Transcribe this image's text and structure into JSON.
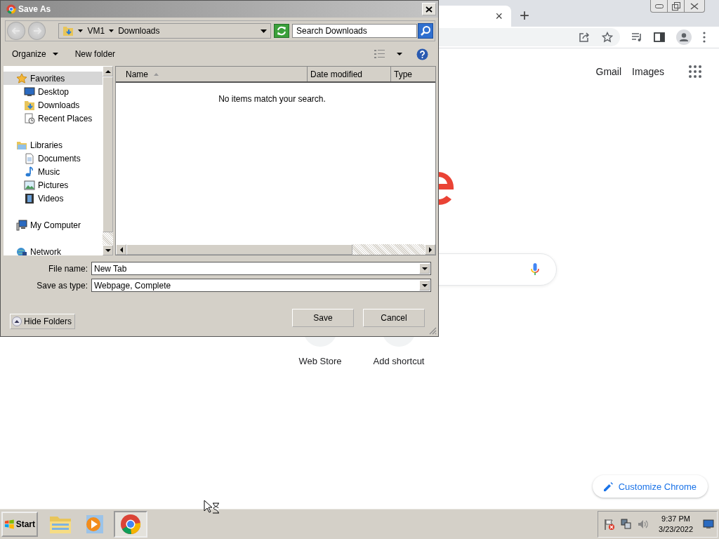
{
  "browser": {
    "tab_close": "×",
    "new_tab": "+",
    "header_links": [
      "Gmail",
      "Images"
    ],
    "shortcuts": [
      "Web Store",
      "Add shortcut"
    ],
    "customize": "Customize Chrome"
  },
  "dialog": {
    "title": "Save As",
    "breadcrumb": [
      "VM1",
      "Downloads"
    ],
    "search": {
      "placeholder": "Search Downloads"
    },
    "commands": [
      {
        "label": "Organize",
        "dropdown": true
      },
      {
        "label": "New folder",
        "dropdown": false
      }
    ],
    "nav": [
      {
        "label": "Favorites",
        "kind": "favorites",
        "selected": true,
        "children": [
          {
            "label": "Desktop",
            "kind": "desktop",
            "selected": false
          },
          {
            "label": "Downloads",
            "kind": "downloads",
            "selected": false
          },
          {
            "label": "Recent Places",
            "kind": "recent",
            "selected": false
          }
        ]
      },
      {
        "label": "Libraries",
        "kind": "libraries",
        "selected": false,
        "children": [
          {
            "label": "Documents",
            "kind": "documents",
            "selected": false
          },
          {
            "label": "Music",
            "kind": "music",
            "selected": false
          },
          {
            "label": "Pictures",
            "kind": "pictures",
            "selected": false
          },
          {
            "label": "Videos",
            "kind": "videos",
            "selected": false
          }
        ]
      },
      {
        "label": "My Computer",
        "kind": "computer",
        "selected": false
      },
      {
        "label": "Network",
        "kind": "network",
        "selected": false
      }
    ],
    "columns": [
      {
        "label": "Name",
        "sorted": true
      },
      {
        "label": "Date modified",
        "sorted": false
      },
      {
        "label": "Type",
        "sorted": false
      }
    ],
    "empty_message": "No items match your search.",
    "fields": [
      {
        "label": "File name:",
        "value": "New Tab"
      },
      {
        "label": "Save as type:",
        "value": "Webpage, Complete"
      }
    ],
    "hide_folders": "Hide Folders",
    "buttons": [
      "Save",
      "Cancel"
    ]
  },
  "taskbar": {
    "start": "Start",
    "apps": [
      {
        "kind": "explorer",
        "selected": false
      },
      {
        "kind": "media",
        "selected": false
      },
      {
        "kind": "browser",
        "selected": true
      }
    ],
    "time": "9:37 PM",
    "date": "3/23/2022"
  }
}
